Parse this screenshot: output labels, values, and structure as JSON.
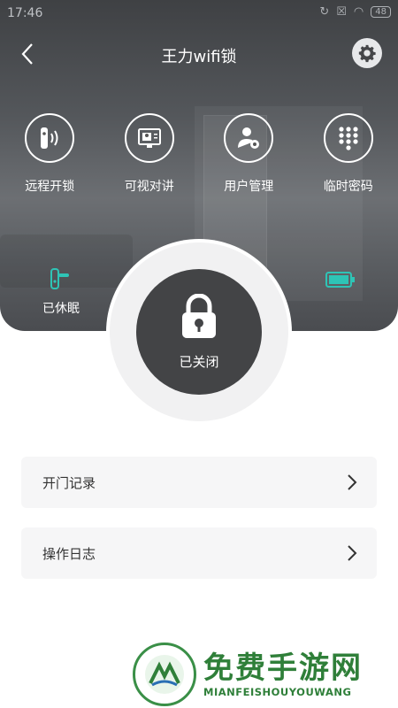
{
  "status_bar": {
    "time": "17:46",
    "battery": "48"
  },
  "header": {
    "title": "王力wifi锁"
  },
  "actions": [
    {
      "label": "远程开锁",
      "icon": "remote-unlock-icon"
    },
    {
      "label": "可视对讲",
      "icon": "video-intercom-icon"
    },
    {
      "label": "用户管理",
      "icon": "user-manage-icon"
    },
    {
      "label": "临时密码",
      "icon": "keypad-icon"
    }
  ],
  "sleep": {
    "label": "已休眠"
  },
  "lock": {
    "status": "已关闭"
  },
  "menu": [
    {
      "label": "开门记录"
    },
    {
      "label": "操作日志"
    }
  ],
  "watermark": {
    "title": "免费手游网",
    "subtitle": "MIANFEISHOUYOUWANG"
  },
  "colors": {
    "hero_bg": "#54575b",
    "lock_bg": "#434446",
    "accent_teal": "#2ec4b6",
    "watermark_green": "#2f7f39"
  }
}
